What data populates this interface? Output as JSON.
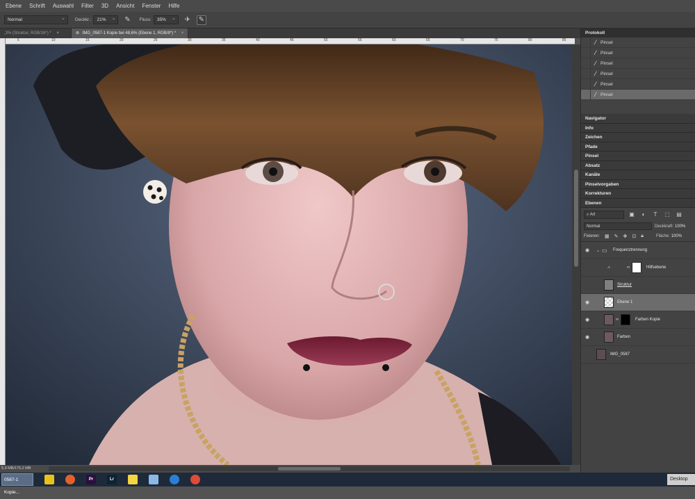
{
  "menu": [
    "Ebene",
    "Schrift",
    "Auswahl",
    "Filter",
    "3D",
    "Ansicht",
    "Fenster",
    "Hilfe"
  ],
  "options": {
    "mode": "Normal",
    "opacity_label": "Deckkr.:",
    "opacity_value": "21%",
    "flow_label": "Fluss:",
    "flow_value": "35%"
  },
  "tabs": [
    {
      "label": ",3% (Struktur, RGB/16*) *",
      "close": "×"
    },
    {
      "label": "IMG_0587-1 Kopie bei 48,6% (Ebene 1, RGB/8*) *",
      "close": "×"
    }
  ],
  "ruler_ticks": [
    "5",
    "10",
    "15",
    "20",
    "25",
    "30",
    "35",
    "40",
    "45",
    "50",
    "55",
    "60",
    "65",
    "70",
    "75",
    "80",
    "85"
  ],
  "status": "5,9 MB/175,2 MB",
  "history": {
    "title": "Protokoll",
    "items": [
      "Pinsel",
      "Pinsel",
      "Pinsel",
      "Pinsel",
      "Pinsel",
      "Pinsel"
    ]
  },
  "collapsed_panels": [
    "Navigator",
    "Info",
    "Zeichen",
    "Pfade",
    "Pinsel",
    "Absatz",
    "Kanäle",
    "Pinselvorgaben",
    "Korrekturen",
    "Ebenen"
  ],
  "layers_panel": {
    "filter_kind": "Art",
    "blend_mode": "Normal",
    "opacity_label": "Deckkraft:",
    "opacity_value": "100%",
    "lock_label": "Fixieren:",
    "fill_label": "Fläche:",
    "fill_value": "100%",
    "layers": [
      {
        "name": "Frequenztrennung"
      },
      {
        "name": "Hilfsebene"
      },
      {
        "name": "Struktur"
      },
      {
        "name": "Ebene 1"
      },
      {
        "name": "Farben Kopie"
      },
      {
        "name": "Farben"
      },
      {
        "name": "IMG_0587"
      }
    ]
  },
  "taskbar": {
    "active_label": "0587-1 Kopie...",
    "desktop_label": "Desktop"
  },
  "colors": {
    "ui_dark": "#434343",
    "panel_header": "#2f2f2f",
    "selected_row": "#6c6c6c",
    "taskbar": "#1e2a3a"
  }
}
